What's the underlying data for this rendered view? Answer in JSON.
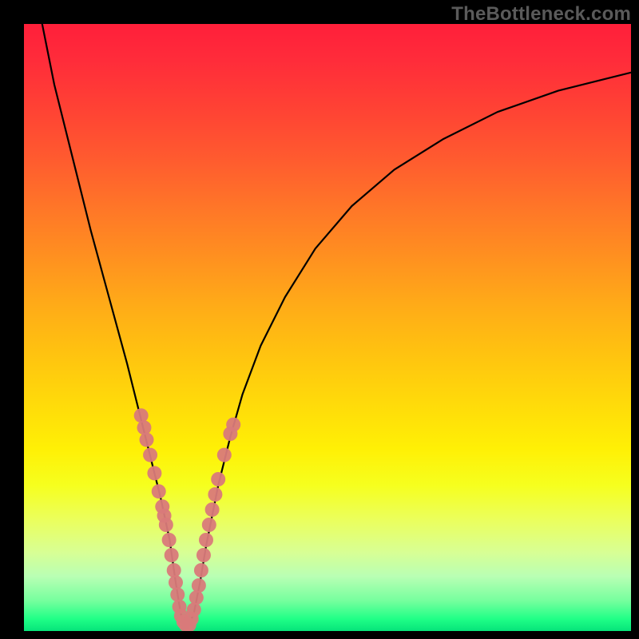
{
  "watermark": {
    "text": "TheBottleneck.com"
  },
  "chart_data": {
    "type": "line",
    "title": "",
    "xlabel": "",
    "ylabel": "",
    "xlim": [
      0,
      100
    ],
    "ylim": [
      0,
      100
    ],
    "grid": false,
    "series": [
      {
        "name": "bottleneck-curve",
        "color": "#000000",
        "x": [
          3,
          5,
          8,
          11,
          14,
          17,
          19,
          21,
          22.5,
          24,
          25,
          25.8,
          26.5,
          27,
          28,
          29,
          30,
          32,
          34,
          36,
          39,
          43,
          48,
          54,
          61,
          69,
          78,
          88,
          100
        ],
        "y": [
          100,
          90,
          78,
          66,
          55,
          44,
          36,
          28,
          22,
          15,
          8,
          3,
          0.5,
          0.5,
          3,
          8,
          14,
          24,
          32,
          39,
          47,
          55,
          63,
          70,
          76,
          81,
          85.5,
          89,
          92
        ]
      }
    ],
    "scatter": [
      {
        "name": "left-cluster",
        "color": "#d97a7a",
        "points_xy": [
          [
            19.3,
            35.5
          ],
          [
            19.8,
            33.5
          ],
          [
            20.2,
            31.5
          ],
          [
            20.8,
            29.0
          ],
          [
            21.5,
            26.0
          ],
          [
            22.2,
            23.0
          ],
          [
            22.8,
            20.5
          ],
          [
            23.1,
            19.0
          ],
          [
            23.4,
            17.5
          ],
          [
            23.9,
            15.0
          ],
          [
            24.3,
            12.5
          ],
          [
            24.7,
            10.0
          ],
          [
            25.0,
            8.0
          ],
          [
            25.3,
            6.0
          ],
          [
            25.6,
            4.0
          ],
          [
            25.9,
            2.5
          ],
          [
            26.3,
            1.5
          ],
          [
            26.7,
            1.0
          ]
        ]
      },
      {
        "name": "right-cluster",
        "color": "#d97a7a",
        "points_xy": [
          [
            27.2,
            1.0
          ],
          [
            27.6,
            2.0
          ],
          [
            28.0,
            3.5
          ],
          [
            28.4,
            5.5
          ],
          [
            28.8,
            7.5
          ],
          [
            29.2,
            10.0
          ],
          [
            29.6,
            12.5
          ],
          [
            30.0,
            15.0
          ],
          [
            30.5,
            17.5
          ],
          [
            31.0,
            20.0
          ],
          [
            31.5,
            22.5
          ],
          [
            32.0,
            25.0
          ],
          [
            33.0,
            29.0
          ],
          [
            34.0,
            32.5
          ],
          [
            34.5,
            34.0
          ]
        ]
      }
    ],
    "gradient_bands_pct_from_top": [
      {
        "color": "#ff1f3a",
        "stop": 0
      },
      {
        "color": "#ff8f20",
        "stop": 38
      },
      {
        "color": "#fff005",
        "stop": 70
      },
      {
        "color": "#20ff87",
        "stop": 98
      }
    ]
  }
}
